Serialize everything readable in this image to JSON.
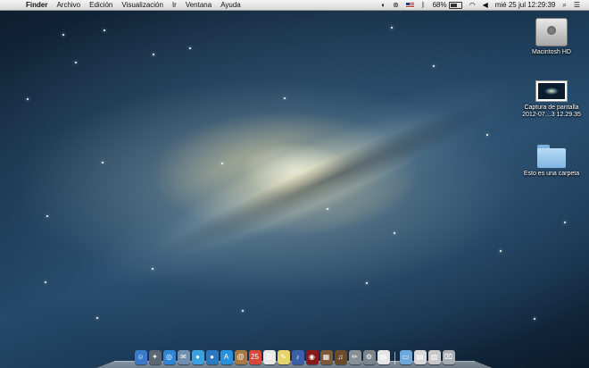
{
  "menubar": {
    "apple_glyph": "",
    "items": [
      "Finder",
      "Archivo",
      "Edición",
      "Visualización",
      "Ir",
      "Ventana",
      "Ayuda"
    ],
    "status": {
      "battery_percent": "68%",
      "battery_level": 0.68,
      "datetime": "mié 25 jul  12:29:39"
    }
  },
  "desktop": {
    "icons": [
      {
        "label": "Macintosh HD",
        "icon": "hard-drive-icon"
      },
      {
        "label_line1": "Captura de pantalla",
        "label_line2": "2012-07…3 12.29.35",
        "icon": "screenshot-icon"
      },
      {
        "label": "Esto es una carpeta",
        "icon": "folder-icon"
      }
    ]
  },
  "dock": {
    "apps": [
      {
        "name": "finder-dock-icon",
        "glyph": "☺",
        "color": "#3a79c8"
      },
      {
        "name": "launchpad-dock-icon",
        "glyph": "✦",
        "color": "#5c6670"
      },
      {
        "name": "safari-dock-icon",
        "glyph": "◎",
        "color": "#2f86d6"
      },
      {
        "name": "mail-dock-icon",
        "glyph": "✉",
        "color": "#6f8fb0"
      },
      {
        "name": "messages-dock-icon",
        "glyph": "●",
        "color": "#3aa0e0"
      },
      {
        "name": "facetime-dock-icon",
        "glyph": "●",
        "color": "#2b78c2"
      },
      {
        "name": "appstore-dock-icon",
        "glyph": "A",
        "color": "#2a8fd9"
      },
      {
        "name": "contacts-dock-icon",
        "glyph": "@",
        "color": "#a77a45"
      },
      {
        "name": "calendar-dock-icon",
        "glyph": "25",
        "color": "#d9463b"
      },
      {
        "name": "reminders-dock-icon",
        "glyph": "☰",
        "color": "#e8e8e8"
      },
      {
        "name": "notes-dock-icon",
        "glyph": "✎",
        "color": "#e7d36b"
      },
      {
        "name": "itunes-dock-icon",
        "glyph": "♪",
        "color": "#3d5fa8"
      },
      {
        "name": "photobooth-dock-icon",
        "glyph": "◉",
        "color": "#8a1a1a"
      },
      {
        "name": "iphoto-dock-icon",
        "glyph": "▦",
        "color": "#7b5a3a"
      },
      {
        "name": "garageband-dock-icon",
        "glyph": "♫",
        "color": "#6a4b2b"
      },
      {
        "name": "iwork-dock-icon",
        "glyph": "✏",
        "color": "#8a8f96"
      },
      {
        "name": "system-preferences-dock-icon",
        "glyph": "⚙",
        "color": "#7d858c"
      },
      {
        "name": "preview-dock-icon",
        "glyph": "▤",
        "color": "#e5e5e5"
      }
    ],
    "stacks": [
      {
        "name": "applications-stack-icon",
        "glyph": "▭",
        "color": "#6ea8db"
      },
      {
        "name": "documents-stack-icon",
        "glyph": "▤",
        "color": "#d8d8d8"
      },
      {
        "name": "downloads-stack-icon",
        "glyph": "▥",
        "color": "#c8c8c8"
      },
      {
        "name": "trash-dock-icon",
        "glyph": "⌧",
        "color": "#a8adb3"
      }
    ]
  }
}
